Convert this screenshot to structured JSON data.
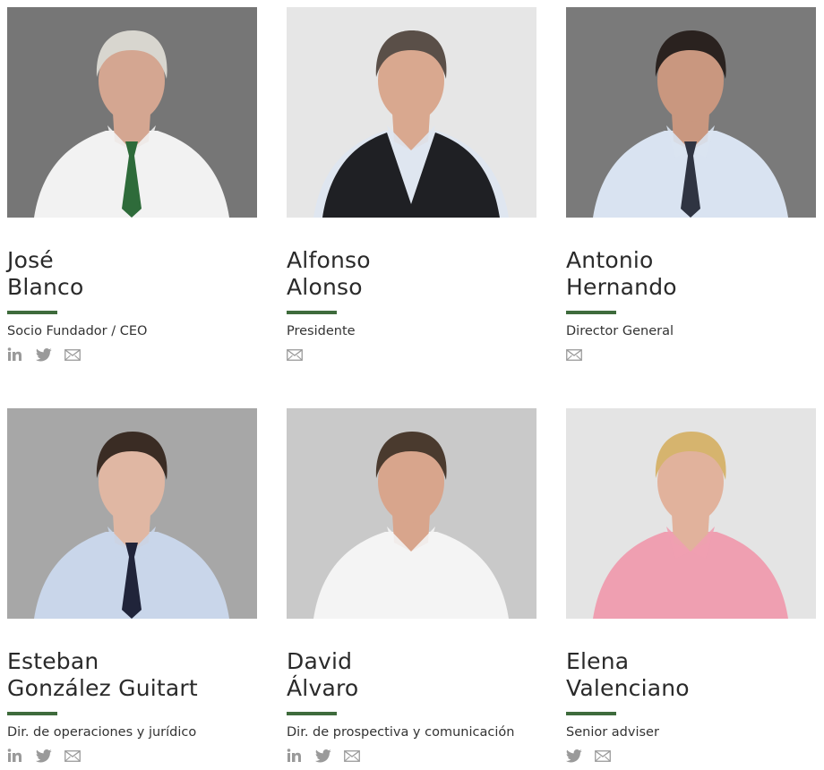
{
  "team": [
    {
      "first": "José",
      "last": "Blanco",
      "role": "Socio Fundador / CEO",
      "socials": [
        "linkedin",
        "twitter",
        "email"
      ],
      "bg": "#767676",
      "shirt": "#f2f2f2",
      "jacket": "",
      "tie": "#2e6b3a",
      "hair": "#d8d6cf",
      "skin": "#d4a691"
    },
    {
      "first": "Alfonso",
      "last": "Alonso",
      "role": "Presidente",
      "socials": [
        "email"
      ],
      "bg": "#e6e6e6",
      "shirt": "#dfe6f0",
      "jacket": "#1f2024",
      "tie": "",
      "hair": "#5a4f48",
      "skin": "#d9a88f"
    },
    {
      "first": "Antonio",
      "last": "Hernando",
      "role": "Director General",
      "socials": [
        "email"
      ],
      "bg": "#7a7a7a",
      "shirt": "#d9e3f1",
      "jacket": "",
      "tie": "#2f3442",
      "hair": "#2a221f",
      "skin": "#c9977f"
    },
    {
      "first": "Esteban",
      "last": "González Guitart",
      "role": "Dir. de operaciones y jurídico",
      "socials": [
        "linkedin",
        "twitter",
        "email"
      ],
      "bg": "#a7a7a7",
      "shirt": "#c9d6ea",
      "jacket": "",
      "tie": "#20243a",
      "hair": "#3a2c24",
      "skin": "#e0b7a3"
    },
    {
      "first": "David",
      "last": "Álvaro",
      "role": "Dir. de prospectiva y comunicación",
      "socials": [
        "linkedin",
        "twitter",
        "email"
      ],
      "bg": "#c9c9c9",
      "shirt": "#f4f4f4",
      "jacket": "",
      "tie": "",
      "hair": "#4a3a2e",
      "skin": "#d8a58c"
    },
    {
      "first": "Elena",
      "last": "Valenciano",
      "role": "Senior adviser",
      "socials": [
        "twitter",
        "email"
      ],
      "bg": "#e4e4e4",
      "shirt": "#ef9fb1",
      "jacket": "",
      "tie": "",
      "hair": "#d6b46e",
      "skin": "#e1b29c"
    }
  ],
  "accent": "#3e6b3c",
  "icon_color": "#9a9a9a"
}
